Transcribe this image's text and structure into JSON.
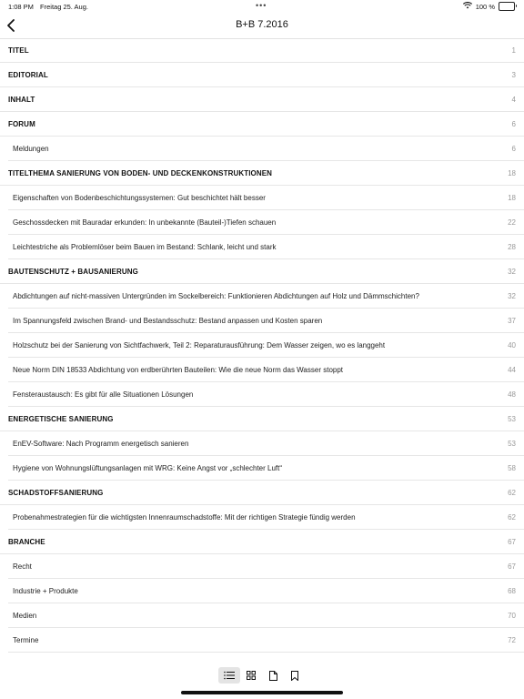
{
  "status_bar": {
    "time": "1:08 PM",
    "date": "Freitag 25. Aug.",
    "battery": "100 %",
    "battery_level": 1.0,
    "icons": [
      "wifi-icon",
      "battery-icon"
    ]
  },
  "nav": {
    "title": "B+B  7.2016",
    "back_icon": "chevron-left-icon"
  },
  "toc": [
    {
      "kind": "section",
      "title": "TITEL",
      "page": "1"
    },
    {
      "kind": "section",
      "title": "EDITORIAL",
      "page": "3"
    },
    {
      "kind": "section",
      "title": "INHALT",
      "page": "4"
    },
    {
      "kind": "section",
      "title": "FORUM",
      "page": "6"
    },
    {
      "kind": "article",
      "title": "Meldungen",
      "page": "6"
    },
    {
      "kind": "section",
      "title": "TITELTHEMA SANIERUNG VON BODEN- UND DECKENKONSTRUKTIONEN",
      "page": "18"
    },
    {
      "kind": "article",
      "title": "Eigenschaften von Bodenbeschichtungssystemen: Gut beschichtet hält besser",
      "page": "18"
    },
    {
      "kind": "article",
      "title": "Geschossdecken mit Bauradar erkunden: In unbekannte (Bauteil-)Tiefen schauen",
      "page": "22"
    },
    {
      "kind": "article",
      "title": "Leichtestriche als Problemlöser beim Bauen im Bestand: Schlank, leicht und stark",
      "page": "28"
    },
    {
      "kind": "section",
      "title": "BAUTENSCHUTZ + BAUSANIERUNG",
      "page": "32"
    },
    {
      "kind": "article",
      "title": "Abdichtungen auf nicht-massiven Untergründen im Sockelbereich: Funktionieren Abdichtungen auf Holz und Dämmschichten?",
      "page": "32"
    },
    {
      "kind": "article",
      "title": "Im Spannungsfeld zwischen Brand- und Bestandsschutz: Bestand anpassen und Kosten sparen",
      "page": "37"
    },
    {
      "kind": "article",
      "title": "Holzschutz bei der Sanierung von Sichtfachwerk, Teil 2: Reparaturausführung: Dem Wasser zeigen, wo es langgeht",
      "page": "40"
    },
    {
      "kind": "article",
      "title": "Neue Norm DIN 18533 Abdichtung von erdberührten Bauteilen: Wie die neue Norm das Wasser stoppt",
      "page": "44"
    },
    {
      "kind": "article",
      "title": "Fensteraustausch: Es gibt für alle Situationen Lösungen",
      "page": "48"
    },
    {
      "kind": "section",
      "title": "ENERGETISCHE SANIERUNG",
      "page": "53"
    },
    {
      "kind": "article",
      "title": "EnEV-Software: Nach Programm energetisch sanieren",
      "page": "53"
    },
    {
      "kind": "article",
      "title": "Hygiene von Wohnungslüftungsanlagen mit WRG: Keine Angst vor „schlechter Luft“",
      "page": "58"
    },
    {
      "kind": "section",
      "title": "SCHADSTOFFSANIERUNG",
      "page": "62"
    },
    {
      "kind": "article",
      "title": "Probenahmestrategien für die wichtigsten Innenraumschadstoffe: Mit der richtigen Strategie fündig werden",
      "page": "62"
    },
    {
      "kind": "section",
      "title": "BRANCHE",
      "page": "67"
    },
    {
      "kind": "article",
      "title": "Recht",
      "page": "67"
    },
    {
      "kind": "article",
      "title": "Industrie + Produkte",
      "page": "68"
    },
    {
      "kind": "article",
      "title": "Medien",
      "page": "70"
    },
    {
      "kind": "article",
      "title": "Termine",
      "page": "72"
    }
  ],
  "toolbar": {
    "buttons": [
      {
        "icon": "list-icon",
        "active": true
      },
      {
        "icon": "grid-icon",
        "active": false
      },
      {
        "icon": "page-icon",
        "active": false
      },
      {
        "icon": "bookmark-icon",
        "active": false
      }
    ]
  }
}
